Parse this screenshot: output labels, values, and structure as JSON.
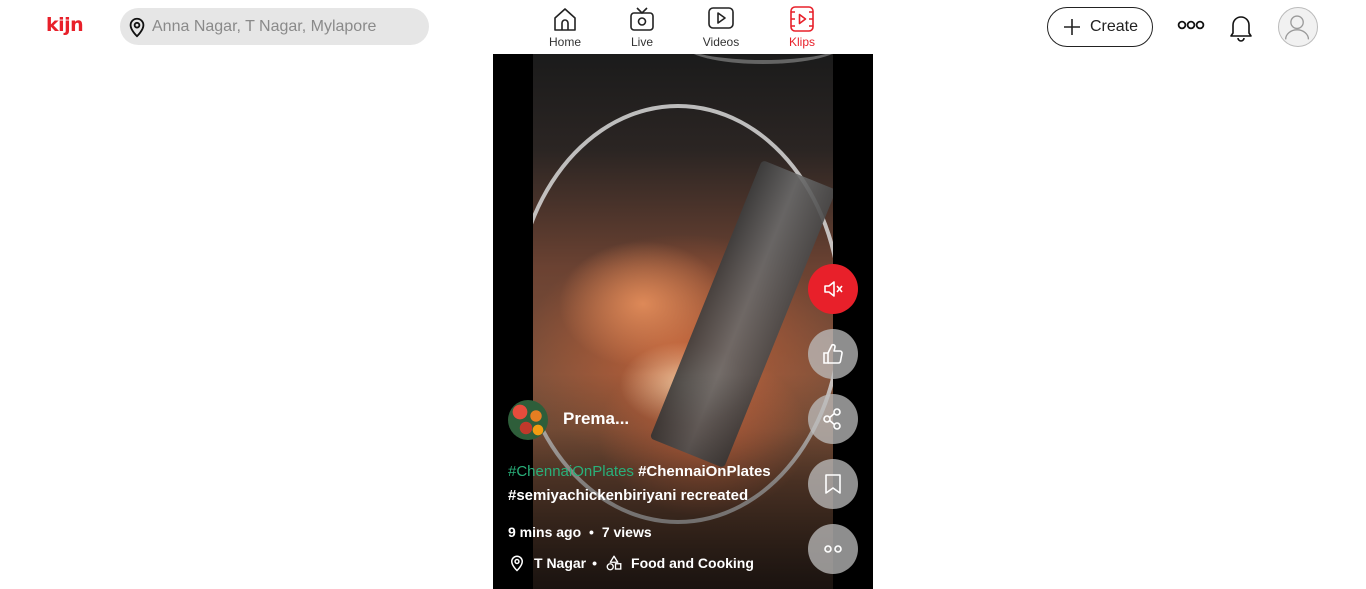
{
  "header": {
    "logo_text": "kijn",
    "brand_color": "#e8202a",
    "search": {
      "placeholder": "Anna Nagar, T Nagar, Mylapore"
    },
    "nav": [
      {
        "label": "Home",
        "icon": "home-icon",
        "active": false
      },
      {
        "label": "Live",
        "icon": "tv-icon",
        "active": false
      },
      {
        "label": "Videos",
        "icon": "play-icon",
        "active": false
      },
      {
        "label": "Klips",
        "icon": "klips-icon",
        "active": true
      }
    ],
    "create_label": "Create"
  },
  "klip": {
    "author": "Prema...",
    "caption_tag_green": "#ChennaiOnPlates",
    "caption_tag": "#ChennaiOnPlates",
    "caption_line2": "#semiyachickenbiriyani recreated",
    "time_ago": "9 mins ago",
    "meta_dot": "•",
    "views": "7 views",
    "location": "T Nagar",
    "category": "Food and Cooking",
    "muted": true
  }
}
